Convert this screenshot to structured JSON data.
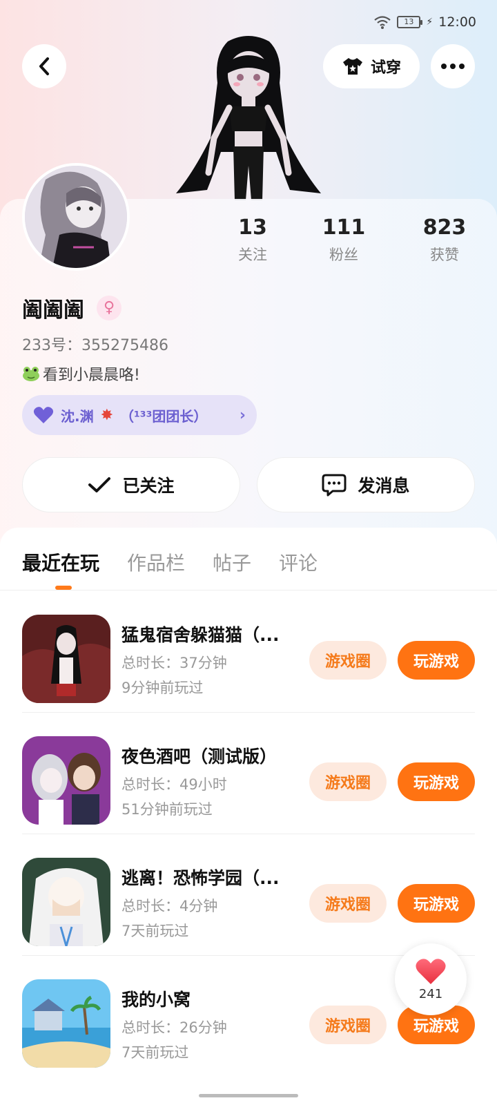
{
  "status_bar": {
    "battery": "13",
    "time": "12:00"
  },
  "header": {
    "tryon_label": "试穿"
  },
  "profile": {
    "username": "阖阖阖",
    "user_id": "233号：355275486",
    "bio": "看到小晨晨咯!",
    "relation": {
      "name": "沈.渊",
      "title": "（¹³³团团长）"
    },
    "stats": [
      {
        "value": "13",
        "label": "关注"
      },
      {
        "value": "111",
        "label": "粉丝"
      },
      {
        "value": "823",
        "label": "获赞"
      }
    ],
    "follow_label": "已关注",
    "message_label": "发消息"
  },
  "tabs": [
    {
      "label": "最近在玩",
      "active": true
    },
    {
      "label": "作品栏",
      "active": false
    },
    {
      "label": "帖子",
      "active": false
    },
    {
      "label": "评论",
      "active": false
    }
  ],
  "games": [
    {
      "title": "猛鬼宿舍躲猫猫（...",
      "duration": "总时长：37分钟",
      "last_played": "9分钟前玩过",
      "circle_label": "游戏圈",
      "play_label": "玩游戏"
    },
    {
      "title": "夜色酒吧（测试版）",
      "duration": "总时长：49小时",
      "last_played": "51分钟前玩过",
      "circle_label": "游戏圈",
      "play_label": "玩游戏"
    },
    {
      "title": "逃离！恐怖学园（...",
      "duration": "总时长：4分钟",
      "last_played": "7天前玩过",
      "circle_label": "游戏圈",
      "play_label": "玩游戏"
    },
    {
      "title": "我的小窝",
      "duration": "总时长：26分钟",
      "last_played": "7天前玩过",
      "circle_label": "游戏圈",
      "play_label": "玩游戏"
    }
  ],
  "like_count": "241",
  "colors": {
    "accent": "#ff7312",
    "accent_light": "#fde9de",
    "relation_bg": "#e6e2f8",
    "relation_text": "#6b5fd0"
  },
  "icons": [
    "back-icon",
    "shirt-icon",
    "more-icon",
    "check-icon",
    "chat-icon",
    "heart-icon",
    "gender-female-icon",
    "wifi-icon",
    "battery-icon",
    "frog-emoji-icon",
    "anger-emoji-icon"
  ]
}
